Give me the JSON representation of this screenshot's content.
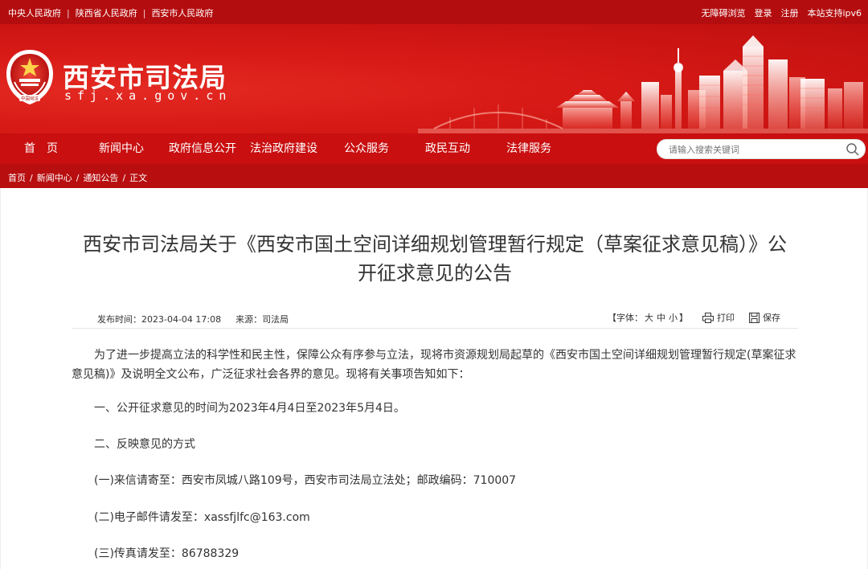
{
  "topbar": {
    "links_left": [
      "中央人民政府",
      "陕西省人民政府",
      "西安市人民政府"
    ],
    "links_right": [
      "无障碍浏览",
      "登录",
      "注册",
      "本站支持ipv6"
    ]
  },
  "header": {
    "title": "西安市司法局",
    "domain": "sfj.xa.gov.cn",
    "emblem_text": "中国司法"
  },
  "nav": {
    "items": [
      "首　页",
      "新闻中心",
      "政府信息公开",
      "法治政府建设",
      "公众服务",
      "政民互动",
      "法律服务"
    ],
    "search_placeholder": "请输入搜索关键词"
  },
  "breadcrumb": [
    "首页",
    "新闻中心",
    "通知公告",
    "正文"
  ],
  "article": {
    "title": "西安市司法局关于《西安市国土空间详细规划管理暂行规定（草案征求意见稿）》公开征求意见的公告",
    "publish_time": "发布时间：2023-04-04 17:08",
    "source": "来源：司法局",
    "font_size_label": "【字体：",
    "font_sizes": [
      "大",
      "中",
      "小"
    ],
    "font_size_end": "】",
    "print_label": "打印",
    "save_label": "保存",
    "paragraphs": [
      "为了进一步提高立法的科学性和民主性，保障公众有序参与立法，现将市资源规划局起草的《西安市国土空间详细规划管理暂行规定(草案征求意见稿)》及说明全文公布，广泛征求社会各界的意见。现将有关事项告知如下：",
      "一、公开征求意见的时间为2023年4月4日至2023年5月4日。",
      "二、反映意见的方式",
      "(一)来信请寄至：西安市凤城八路109号，西安市司法局立法处；邮政编码：710007",
      "(二)电子邮件请发至：xassfjlfc@163.com",
      "(三)传真请发至：86788329"
    ]
  },
  "colors": {
    "primary": "#c90f10",
    "topbar": "#b40d0f",
    "text": "#333333"
  }
}
